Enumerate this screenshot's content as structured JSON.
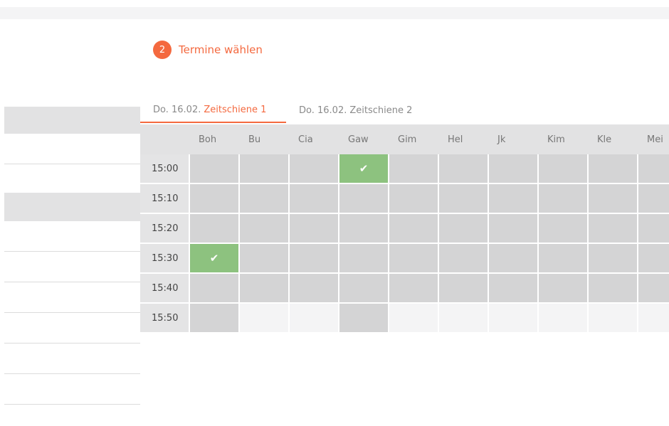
{
  "step": {
    "number": "2",
    "title": "Termine wählen"
  },
  "tabs": [
    {
      "date": "Do. 16.02.",
      "label": "Zeitschiene 1",
      "active": true
    },
    {
      "date": "Do. 16.02.",
      "label": "Zeitschiene 2",
      "active": false
    }
  ],
  "columns": [
    "Boh",
    "Bu",
    "Cia",
    "Gaw",
    "Gim",
    "Hel",
    "Jk",
    "Kim",
    "Kle",
    "Mei"
  ],
  "rows": [
    {
      "time": "15:00",
      "slots": [
        "s",
        "s",
        "s",
        "b",
        "s",
        "s",
        "s",
        "s",
        "s",
        "s"
      ]
    },
    {
      "time": "15:10",
      "slots": [
        "s",
        "s",
        "s",
        "s",
        "s",
        "s",
        "s",
        "s",
        "s",
        "s"
      ]
    },
    {
      "time": "15:20",
      "slots": [
        "s",
        "s",
        "s",
        "s",
        "s",
        "s",
        "s",
        "s",
        "s",
        "s"
      ]
    },
    {
      "time": "15:30",
      "slots": [
        "b",
        "s",
        "s",
        "s",
        "s",
        "s",
        "s",
        "s",
        "s",
        "s"
      ]
    },
    {
      "time": "15:40",
      "slots": [
        "s",
        "s",
        "s",
        "s",
        "s",
        "s",
        "s",
        "s",
        "s",
        "s"
      ]
    },
    {
      "time": "15:50",
      "slots": [
        "s",
        "e",
        "e",
        "s",
        "e",
        "e",
        "e",
        "e",
        "e",
        "e"
      ]
    }
  ],
  "slot_legend": {
    "s": "available",
    "b": "booked",
    "e": "unavailable"
  },
  "check_glyph": "✔",
  "colors": {
    "accent": "#f4693f",
    "booked": "#8dc27f",
    "available": "#d4d4d5",
    "unavailable": "#f4f4f5"
  }
}
